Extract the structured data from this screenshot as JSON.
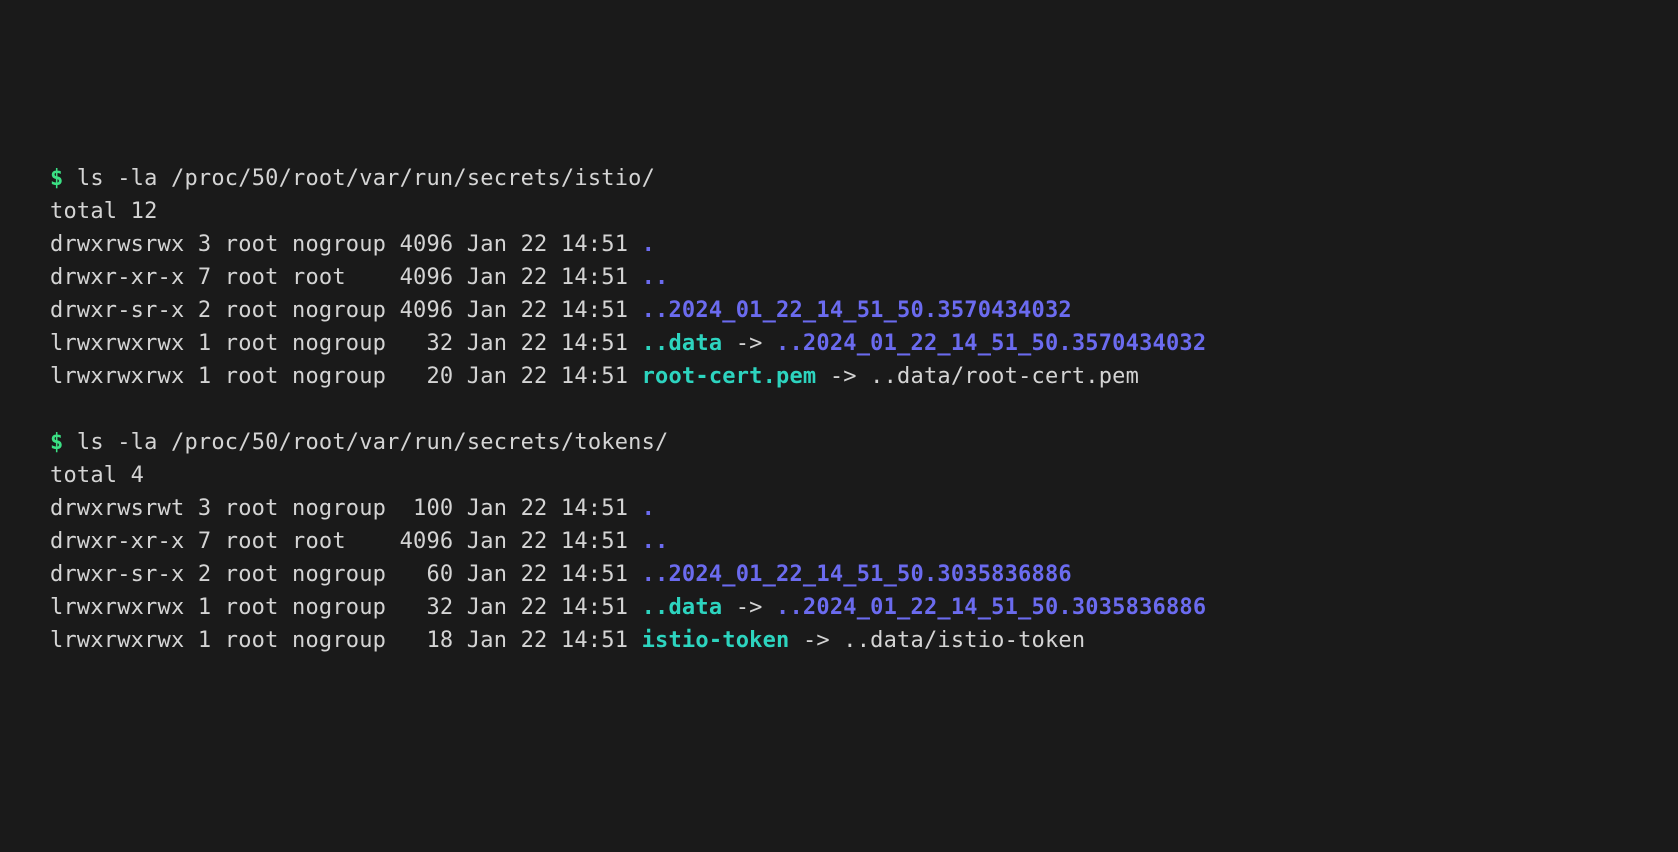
{
  "commands": [
    {
      "prompt": "$",
      "cmd": "ls -la /proc/50/root/var/run/secrets/istio/",
      "total": "total 12",
      "rows": [
        {
          "perm": "drwxrwsrwx",
          "links": "3",
          "user": "root",
          "group": "nogroup",
          "size": "4096",
          "date": "Jan 22 14:51",
          "name": ".",
          "type": "dir"
        },
        {
          "perm": "drwxr-xr-x",
          "links": "7",
          "user": "root",
          "group": "root   ",
          "size": "4096",
          "date": "Jan 22 14:51",
          "name": "..",
          "type": "dir"
        },
        {
          "perm": "drwxr-sr-x",
          "links": "2",
          "user": "root",
          "group": "nogroup",
          "size": "4096",
          "date": "Jan 22 14:51",
          "name": "..2024_01_22_14_51_50.3570434032",
          "type": "dir"
        },
        {
          "perm": "lrwxrwxrwx",
          "links": "1",
          "user": "root",
          "group": "nogroup",
          "size": "  32",
          "date": "Jan 22 14:51",
          "name": "..data",
          "type": "symlink",
          "target": "..2024_01_22_14_51_50.3570434032",
          "targetType": "dir"
        },
        {
          "perm": "lrwxrwxrwx",
          "links": "1",
          "user": "root",
          "group": "nogroup",
          "size": "  20",
          "date": "Jan 22 14:51",
          "name": "root-cert.pem",
          "type": "symlink",
          "target": "..data/root-cert.pem",
          "targetType": "plain"
        }
      ]
    },
    {
      "prompt": "$",
      "cmd": "ls -la /proc/50/root/var/run/secrets/tokens/",
      "total": "total 4",
      "rows": [
        {
          "perm": "drwxrwsrwt",
          "links": "3",
          "user": "root",
          "group": "nogroup",
          "size": " 100",
          "date": "Jan 22 14:51",
          "name": ".",
          "type": "dir"
        },
        {
          "perm": "drwxr-xr-x",
          "links": "7",
          "user": "root",
          "group": "root   ",
          "size": "4096",
          "date": "Jan 22 14:51",
          "name": "..",
          "type": "dir"
        },
        {
          "perm": "drwxr-sr-x",
          "links": "2",
          "user": "root",
          "group": "nogroup",
          "size": "  60",
          "date": "Jan 22 14:51",
          "name": "..2024_01_22_14_51_50.3035836886",
          "type": "dir"
        },
        {
          "perm": "lrwxrwxrwx",
          "links": "1",
          "user": "root",
          "group": "nogroup",
          "size": "  32",
          "date": "Jan 22 14:51",
          "name": "..data",
          "type": "symlink",
          "target": "..2024_01_22_14_51_50.3035836886",
          "targetType": "dir"
        },
        {
          "perm": "lrwxrwxrwx",
          "links": "1",
          "user": "root",
          "group": "nogroup",
          "size": "  18",
          "date": "Jan 22 14:51",
          "name": "istio-token",
          "type": "symlink",
          "target": "..data/istio-token",
          "targetType": "plain"
        }
      ]
    }
  ]
}
